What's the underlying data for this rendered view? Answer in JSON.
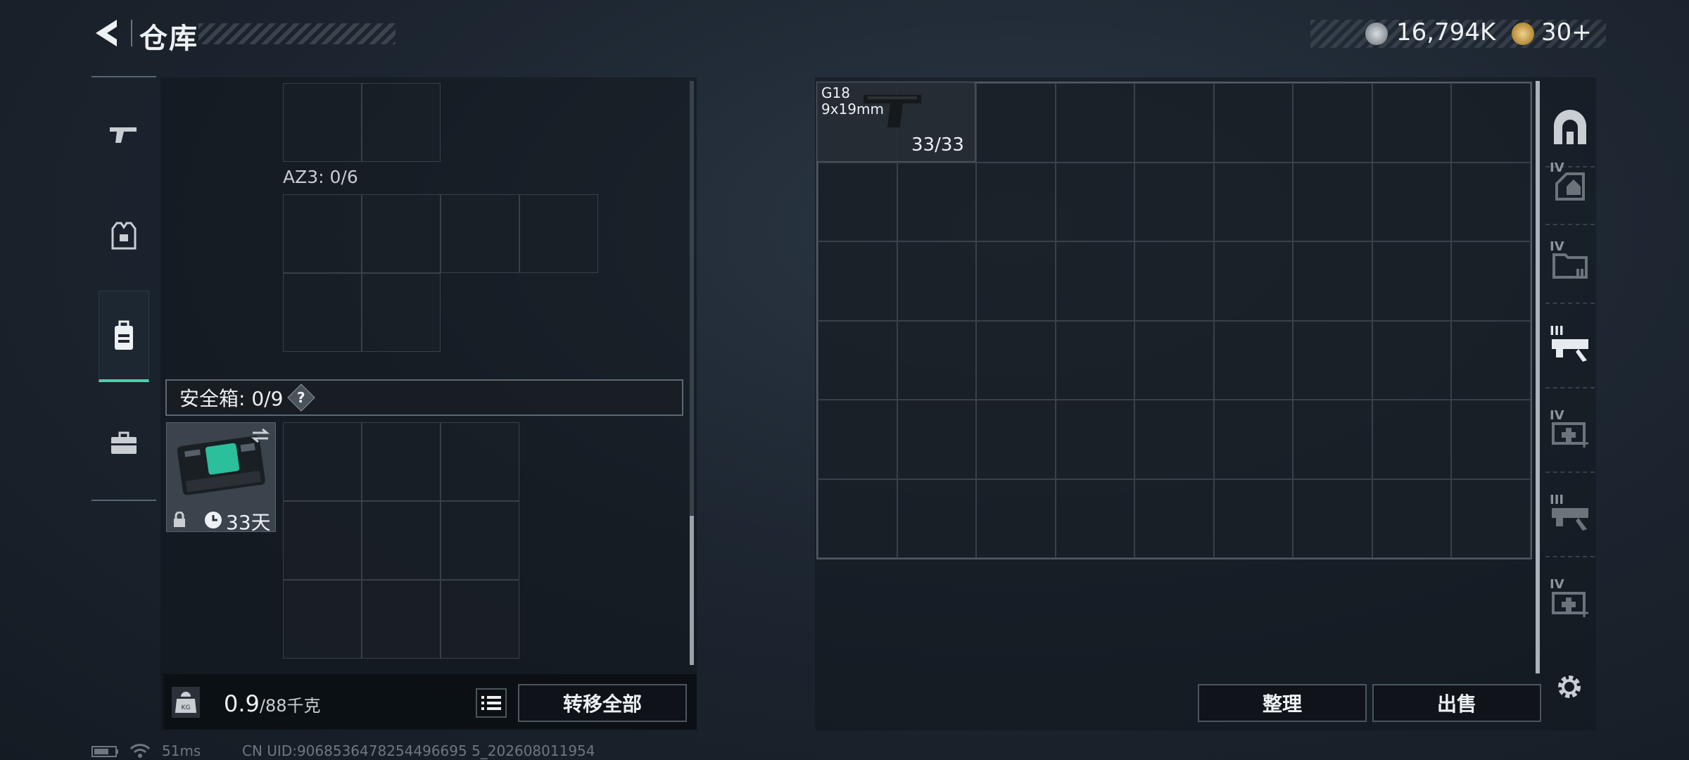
{
  "header": {
    "title": "仓库",
    "currency": {
      "silver": "16,794K",
      "gold": "30+"
    }
  },
  "sidebar": {
    "items": [
      {
        "icon": "pistol-icon"
      },
      {
        "icon": "armor-vest-icon"
      },
      {
        "icon": "backpack-icon",
        "active": true
      },
      {
        "icon": "toolbox-icon"
      }
    ]
  },
  "left_panel": {
    "container_label": "AZ3: 0/6",
    "safe_box": {
      "label": "安全箱: 0/9",
      "help": "?",
      "duration": "33天"
    }
  },
  "bottom_left": {
    "weight_value": "0.9",
    "weight_limit": "/88千克",
    "transfer_all": "转移全部"
  },
  "stash": {
    "items": [
      {
        "name": "G18",
        "caliber": "9x19mm",
        "ammo": "33/33"
      }
    ],
    "columns": 9,
    "rows": 6
  },
  "right_actions": {
    "organize": "整理",
    "sell": "出售"
  },
  "categories": [
    {
      "icon": "stash-main-icon",
      "tier": ""
    },
    {
      "icon": "helmet-icon",
      "tier": "IV"
    },
    {
      "icon": "folder-icon",
      "tier": "IV"
    },
    {
      "icon": "rifle-mod-icon",
      "tier": "III"
    },
    {
      "icon": "medkit-icon",
      "tier": "IV"
    },
    {
      "icon": "rifle-mod-icon",
      "tier": "III"
    },
    {
      "icon": "medkit-icon",
      "tier": "IV"
    }
  ],
  "status_bar": {
    "ping": "51ms",
    "uid": "CN UID:9068536478254496695 5_202608011954"
  }
}
